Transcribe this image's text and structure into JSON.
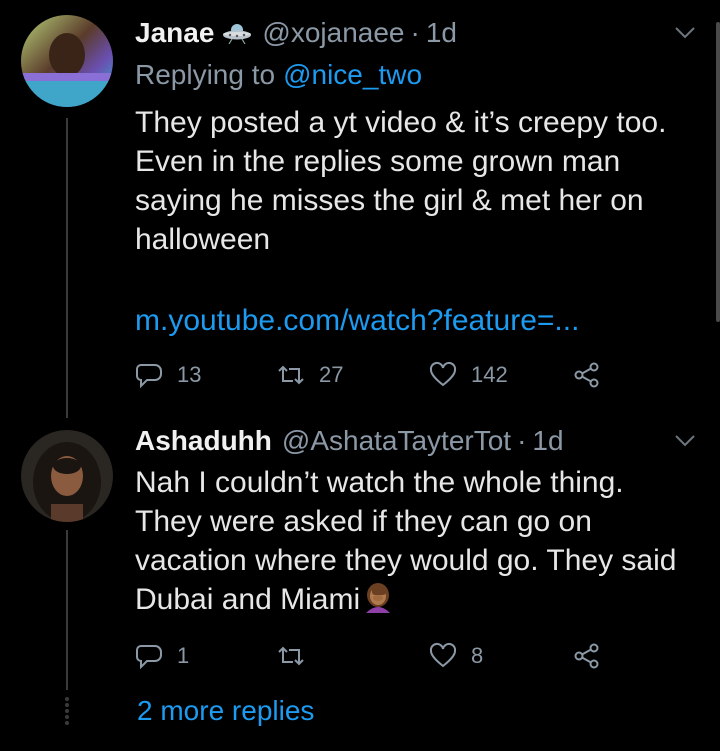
{
  "tweets": [
    {
      "name": "Janae",
      "badge_icon": "ufo-icon",
      "handle": "@xojanaee",
      "dot": "·",
      "time": "1d",
      "replying_prefix": "Replying to",
      "replying_mention": "@nice_two",
      "text": "They posted a yt video & it’s creepy too. Even in the replies some grown man saying he misses the girl & met her on halloween",
      "link": "m.youtube.com/watch?feature=...",
      "replies": "13",
      "retweets": "27",
      "likes": "142"
    },
    {
      "name": "Ashaduhh",
      "handle": "@AshataTayterTot",
      "dot": "·",
      "time": "1d",
      "text_line1": "Nah I couldn’t watch the whole thing.",
      "text_line2": "They were asked if they can go on",
      "text_line3": "vacation where they would go. They said",
      "text_line4": "Dubai and Miami",
      "emoji_icon": "woman-facepalming-emoji",
      "replies": "1",
      "retweets": "",
      "likes": "8"
    }
  ],
  "more_replies": "2 more replies",
  "colors": {
    "background": "#000000",
    "link": "#1d9bf0",
    "muted": "#8b98a5",
    "text": "#e7e7e7"
  }
}
